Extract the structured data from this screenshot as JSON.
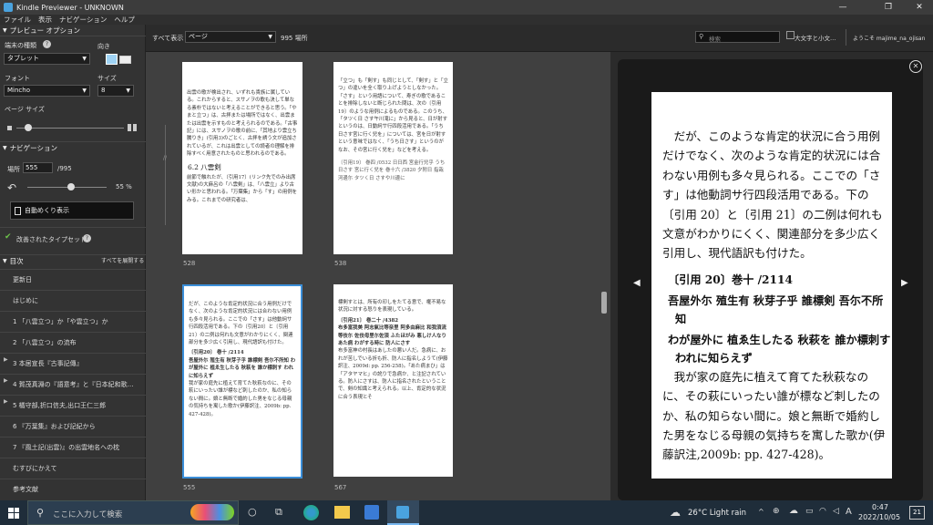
{
  "window": {
    "title": "Kindle Previewer - UNKNOWN",
    "minimize": "—",
    "maximize": "❐",
    "close": "✕"
  },
  "menu": [
    "ファイル",
    "表示",
    "ナビゲーション",
    "ヘルプ"
  ],
  "sidebar": {
    "preview_options": "プレビュー オプション",
    "device_label": "端末の種類",
    "device_value": "タブレット",
    "orientation_label": "向き",
    "font_label": "フォント",
    "font_value": "Mincho",
    "size_label": "サイズ",
    "size_value": "8",
    "page_size_label": "ページ サイズ",
    "navigation": "ナビゲーション",
    "location_label": "場所",
    "location_value": "555",
    "location_total": "/995",
    "progress_text": "55 %",
    "progress_fraction": 0.55,
    "autoflip_label": "自動めくり表示",
    "enhanced_typeset": "改善されたタイプセット",
    "toc": "目次",
    "expand_all": "すべてを展開する",
    "toc_items": [
      "更新日",
      "はじめに",
      "1 「八雲立つ」か「や雲立つ」か",
      "2 「八雲立つ」の流布",
      "3 本居宣長『古事記傳』",
      "4 賀茂真淵の『語意考』と『日本紀和歌…",
      "5 橘守部,折口信夫,出口王仁三郎",
      "6 『万葉集』および記紀から",
      "7 『風土記(出雲)』の出雲地名への枕",
      "むすびにかえて",
      "参考文献"
    ]
  },
  "toolbar": {
    "show_all": "すべて表示",
    "view_value": "ページ",
    "count_text": "995 場所",
    "search_placeholder": "検索",
    "case_label": "大文字と小文…",
    "welcome": "ようこそ majime_na_ojisan"
  },
  "thumbnails": [
    {
      "num": "528",
      "heading": "6.2 八雲剣",
      "text_top": "出雲の歌が検出され、いずれも貴族に属している。これからすると、スサノヲの歌も決して単なる素朴ではないと考えることができると思う。「やまと立つ」は、古拝または場所ではなく、出雲または出雲を示すものと考えられるのである。「古事記」には、スサノヲの歌の前に、「其地より雲立ち騰りき」(引用3)のごとく、古拝を誘う文が追加されているが、これは出雲としての読者の理解を排除すべく用意されたものと思われるのである。",
      "text_bottom": "前節で触れたが、〔引用17〕(リンク先でのみ出席文献)の大麻呂の「八雲剣」は、「八雲立」より古い形かと思われる。「万葉集」から「す」の用例をみる。これまでの研究者は、"
    },
    {
      "num": "538",
      "text_top": "「立つ」も「剣す」も同じとして、「剣す」と「立つ」の違いを全く取り上げようとしなかった。「さす」という用語について、寿ぎの歌であることを排除しないと断じられた問は、次の〔引用19〕のような用例によるものである。このうち、「タツく日 さす午川滝に」から見ると、日が射すというのは、日動詞サ行四段活用である。「うち日さす宮に行く兒を」については、宮を日が射すという意味ではなく、「うち日さす」というのがなお、その宮に行く兒を」などを考える。",
      "text_bottom": "〔引用19〕 巻四 /0532 日日西 宮金行兒乎 うち日さす 宮に行く兒を 巻十六 /3820 夕附日 指哉河邊尓 タツく日 さすや川邊に"
    },
    {
      "num": "555",
      "text_top": "だが、このような肯定的状況に合う用例だけでなく、次のような肯定的状況には合わない用例も多々見られる。ここでの「さす」は他動詞サ行四段活用である。下の〔引用20〕と〔引用21〕の二例は何れも文意がわかりにくく、関連部分を多少広く引用し、現代語訳も付けた。",
      "quote_title": "〔引用20〕 巻十 /2114",
      "quote_body": "吾屋外尓 殖生有 秋芽子乎 誰標剣 吾尓不所知 わが屋外に 植ゑ生したる 秋萩を 誰か標刺す われに知らえず",
      "text_after": "我が家の庭先に植えて育てた秋萩なのに、その萩にいったい誰が標など刺したのか、私の知らない間に。娘と無断で婚約した男をなじる母親の気持ちを寓した歌か(伊藤訳注、2009b: pp. 427-428)。"
    },
    {
      "num": "567",
      "text_top": "標剣すとは、所有の印しをたてる意で、権不易な状況に対する怒りを表現している。",
      "quote_title": "〔引用21〕 巻二十 /4382",
      "quote_body": "布多富我美 阿志氣比等奈里 阿多由麻比 和我須流等伎尓 佐伎母里尓佐須 ふたほがみ 悪しけ人なり あた病 わがする時に 防人にさす",
      "text_after": "布多富神の村長はあしたの悪い人だ。急病に、おれが苦しでいる折も折、防人に指名しようて(伊藤訳注、2009d: pp. 256-258)。「あた病まひ」は「アタヤマヒ」の訛りで急病か、と注記されている。防人にさすは、防人に指名されたということで、剣の知識と考えられる。以上、肯定的な状況に合う表現とそ"
    }
  ],
  "viewer": {
    "para1": "だが、このような肯定的状況に合う用例だけでなく、次のような肯定的状況には合わない用例も多々見られる。ここでの「さす」は他動詞サ行四段活用である。下の〔引用 20〕と〔引用 21〕の二例は何れも文意がわかりにくく、関連部分を多少広く引用し、現代語訳も付けた。",
    "quote_title": "〔引用 20〕巻十 /2114",
    "quote_line1": "吾屋外尓 殖生有 秋芽子乎 誰標剣 吾尓不所知",
    "quote_line2": "わが屋外に 植ゑ生したる 秋萩を 誰か標刺す われに知らえず",
    "para2": "我が家の庭先に植えて育てた秋萩なのに、その萩にいったい誰が標など刺したのか、私の知らない間に。娘と無断で婚約した男をなじる母親の気持ちを寓した歌か(伊藤訳注,2009b: pp. 427-428)。"
  },
  "taskbar": {
    "search_placeholder": "ここに入力して検索",
    "weather": "26°C  Light rain",
    "time": "0:47",
    "date": "2022/10/05",
    "ime": "A",
    "notif": "21"
  }
}
